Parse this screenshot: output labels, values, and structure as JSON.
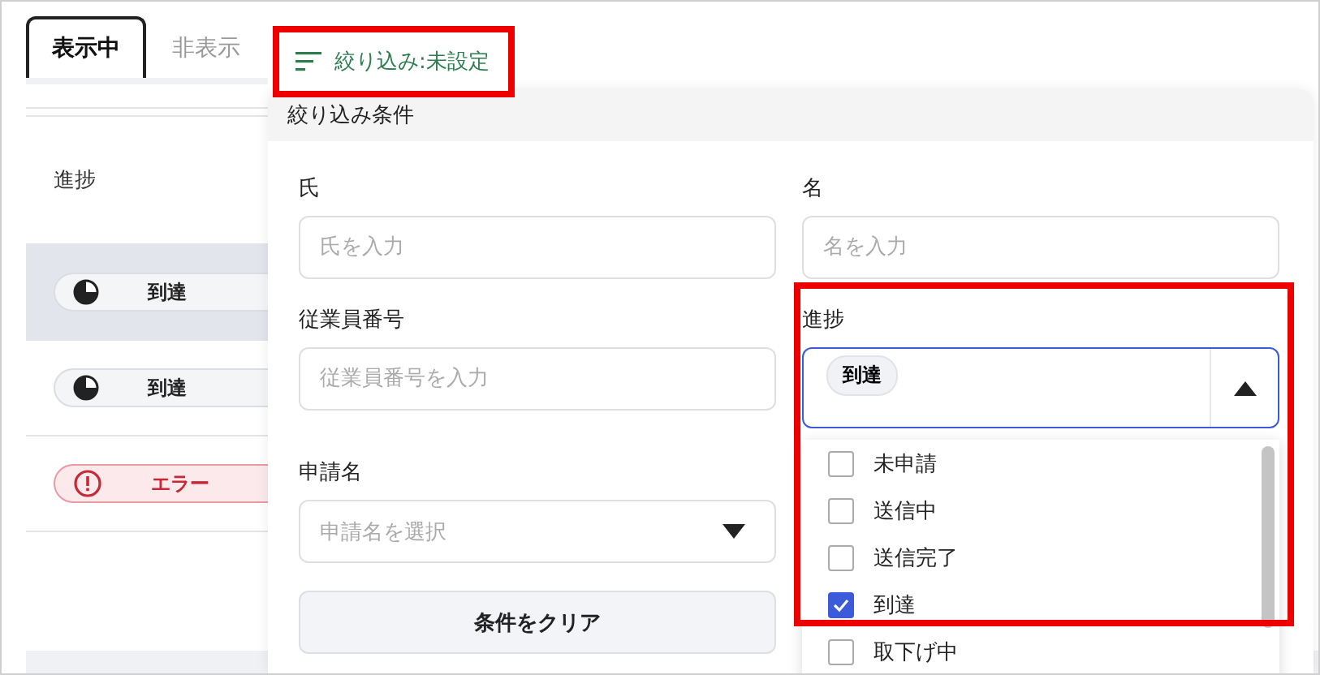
{
  "tabs": [
    {
      "label": "表示中",
      "selected": true
    },
    {
      "label": "非表示",
      "selected": false
    }
  ],
  "filter_button": {
    "label": "絞り込み:未設定",
    "highlighted": true
  },
  "table": {
    "header": "進捗",
    "rows": [
      {
        "status": "到達",
        "kind": "progress",
        "hovered": true
      },
      {
        "status": "到達",
        "kind": "progress",
        "hovered": false
      },
      {
        "status": "エラー",
        "kind": "error",
        "hovered": false
      }
    ]
  },
  "filter_panel": {
    "title": "絞り込み条件",
    "columns": [
      {
        "fields": [
          {
            "kind": "text",
            "label": "氏",
            "placeholder": "氏を入力"
          },
          {
            "kind": "text",
            "label": "従業員番号",
            "placeholder": "従業員番号を入力"
          },
          {
            "kind": "select",
            "label": "申請名",
            "placeholder": "申請名を選択"
          }
        ],
        "button": "条件をクリア"
      },
      {
        "fields": [
          {
            "kind": "text",
            "label": "名",
            "placeholder": "名を入力"
          },
          {
            "kind": "multiselect",
            "label": "進捗",
            "chips": [
              "到達"
            ],
            "expanded": true,
            "highlighted": true,
            "options": [
              {
                "label": "未申請",
                "checked": false
              },
              {
                "label": "送信中",
                "checked": false
              },
              {
                "label": "送信完了",
                "checked": false
              },
              {
                "label": "到達",
                "checked": true
              },
              {
                "label": "取下げ中",
                "checked": false
              }
            ]
          }
        ]
      }
    ]
  }
}
